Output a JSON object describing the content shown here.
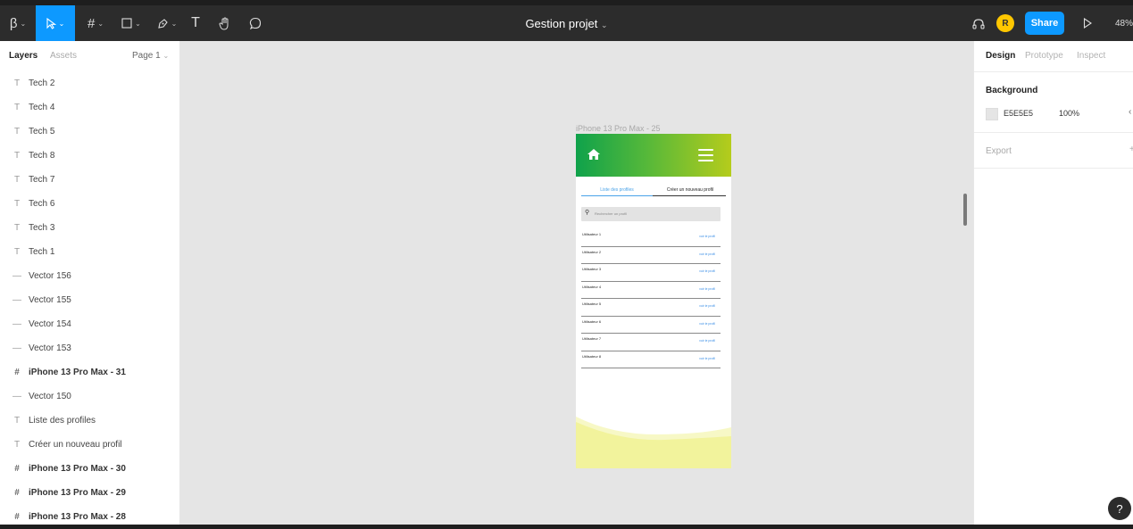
{
  "toolbar": {
    "main_menu": "β",
    "title": "Gestion projet",
    "title_caret": "⌄",
    "avatar_initial": "R",
    "share_label": "Share",
    "zoom": "48%"
  },
  "left_panel": {
    "tab_layers": "Layers",
    "tab_assets": "Assets",
    "page": "Page 1",
    "layers": [
      {
        "icon": "T",
        "label": "Tech 2"
      },
      {
        "icon": "T",
        "label": "Tech 4"
      },
      {
        "icon": "T",
        "label": "Tech 5"
      },
      {
        "icon": "T",
        "label": "Tech 8"
      },
      {
        "icon": "T",
        "label": "Tech 7"
      },
      {
        "icon": "T",
        "label": "Tech 6"
      },
      {
        "icon": "T",
        "label": "Tech 3"
      },
      {
        "icon": "T",
        "label": "Tech 1"
      },
      {
        "icon": "—",
        "label": "Vector 156"
      },
      {
        "icon": "—",
        "label": "Vector 155"
      },
      {
        "icon": "—",
        "label": "Vector 154"
      },
      {
        "icon": "—",
        "label": "Vector 153"
      },
      {
        "icon": "#",
        "label": "iPhone 13 Pro Max - 31"
      },
      {
        "icon": "—",
        "label": "Vector 150"
      },
      {
        "icon": "T",
        "label": "Liste des profiles"
      },
      {
        "icon": "T",
        "label": "Créer un nouveau profil"
      },
      {
        "icon": "#",
        "label": "iPhone 13 Pro Max - 30"
      },
      {
        "icon": "#",
        "label": "iPhone 13 Pro Max - 29"
      },
      {
        "icon": "#",
        "label": "iPhone 13 Pro Max - 28"
      }
    ]
  },
  "canvas": {
    "frame_label": "iPhone 13 Pro Max - 25",
    "tab_list": "Liste des profiles",
    "tab_create": "Créer un nouveau profil",
    "search_placeholder": "Rechercher un profil",
    "users": [
      {
        "name": "Utilisateur 1",
        "link": "voir le profil"
      },
      {
        "name": "Utilisateur 2",
        "link": "voir le profil"
      },
      {
        "name": "Utilisateur 3",
        "link": "voir le profil"
      },
      {
        "name": "Utilisateur 4",
        "link": "voir le profil"
      },
      {
        "name": "Utilisateur 5",
        "link": "voir le profil"
      },
      {
        "name": "Utilisateur 6",
        "link": "voir le profil"
      },
      {
        "name": "Utilisateur 7",
        "link": "voir le profil"
      },
      {
        "name": "Utilisateur 8",
        "link": "voir le profil"
      }
    ]
  },
  "right_panel": {
    "tab_design": "Design",
    "tab_prototype": "Prototype",
    "tab_inspect": "Inspect",
    "background_title": "Background",
    "bg_hex": "E5E5E5",
    "bg_opacity": "100%",
    "export_title": "Export"
  },
  "help_label": "?",
  "colors": {
    "accent": "#0d99ff",
    "canvas": "#e5e5e5",
    "header_gradient_start": "#0fa24b",
    "header_gradient_end": "#b5cc1c",
    "wave": "#f3f4a2"
  }
}
